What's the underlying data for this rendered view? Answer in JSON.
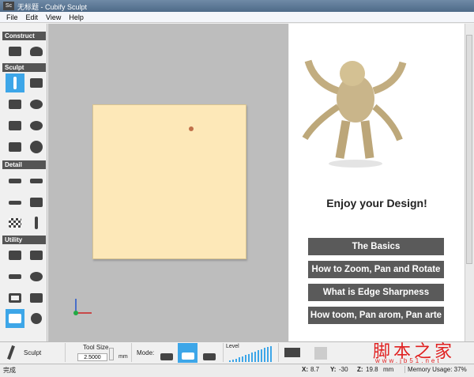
{
  "window": {
    "title": "无标题 - Cubify Sculpt",
    "icon": "Sc"
  },
  "menu": [
    "File",
    "Edit",
    "View",
    "Help"
  ],
  "sections": {
    "construct": "Construct",
    "sculpt": "Sculpt",
    "detail": "Detail",
    "utility": "Utility"
  },
  "right_panel": {
    "heading": "Enjoy your Design!",
    "buttons": [
      "The Basics",
      "How to Zoom, Pan and Rotate",
      "What is Edge Sharpness",
      "How toom, Pan arom, Pan arte"
    ]
  },
  "toolbar": {
    "tool_label": "Sculpt",
    "tool_size_label": "Tool Size",
    "tool_size_value": "2.5000",
    "unit": "mm",
    "mode_label": "Mode:",
    "level_label": "Level"
  },
  "status": {
    "text": "完成",
    "x_label": "X:",
    "x": "8.7",
    "y_label": "Y:",
    "y": "-30",
    "z_label": "Z:",
    "z": "19.8",
    "unit": "mm",
    "memory": "Memory Usage: 37%"
  },
  "watermark": {
    "cn": "脚本之家",
    "url": "www.jb51.net"
  },
  "colors": {
    "accent": "#3da6e8",
    "model": "#fde8b8"
  }
}
